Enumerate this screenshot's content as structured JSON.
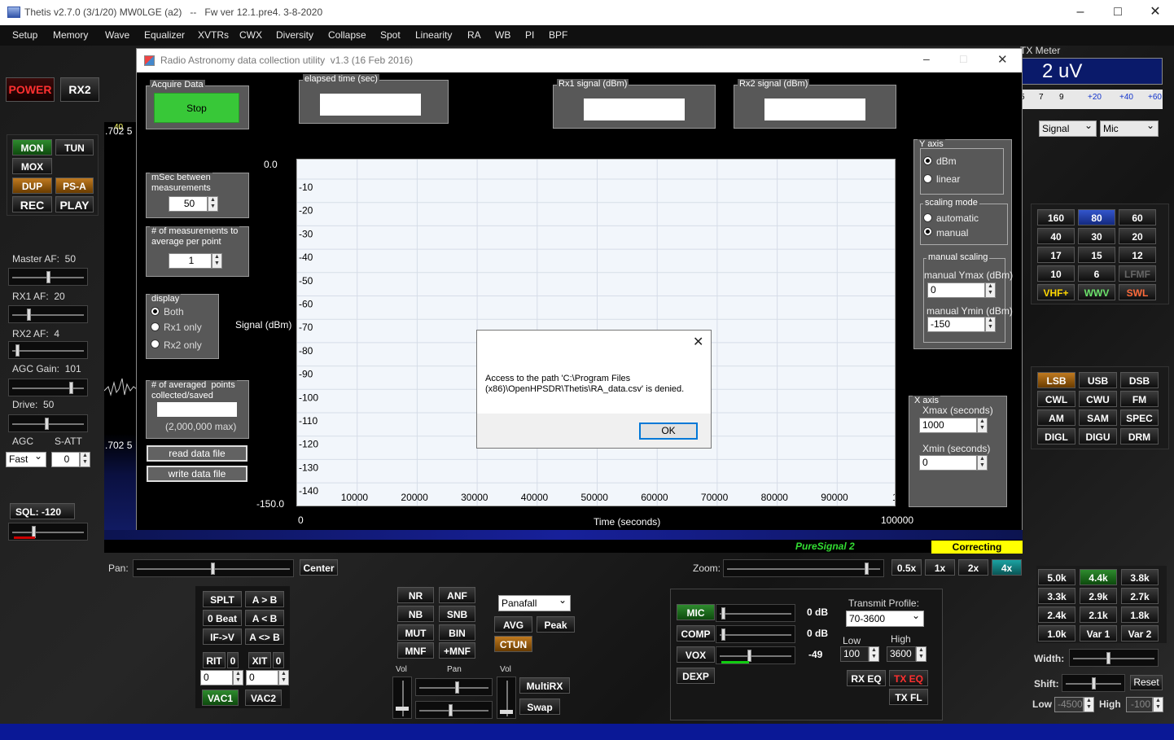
{
  "window": {
    "title": "Thetis v2.7.0 (3/1/20) MW0LGE (a2)   --   Fw ver 12.1.pre4. 3-8-2020"
  },
  "menu": [
    "Setup",
    "Memory",
    "Wave",
    "Equalizer",
    "XVTRs",
    "CWX",
    "Diversity",
    "Collapse",
    "Spot",
    "Linearity",
    "RA",
    "WB",
    "PI",
    "BPF"
  ],
  "left": {
    "power": "POWER",
    "rx2": "RX2",
    "mon": "MON",
    "tun": "TUN",
    "mox": "MOX",
    "dup": "DUP",
    "psa": "PS-A",
    "rec": "REC",
    "play": "PLAY",
    "master_af": "Master AF:  50",
    "rx1_af": "RX1 AF:  20",
    "rx2_af": "RX2 AF:  4",
    "agc_gain": "AGC Gain:  101",
    "drive": "Drive:  50",
    "agc": "AGC",
    "satt": "S-ATT",
    "agc_mode": "Fast",
    "satt_val": "0",
    "sql": "SQL:  -120",
    "freq1": ".702 5",
    "freq2": ".702 5",
    "freq1b": "40"
  },
  "right": {
    "txmeter": "TX Meter",
    "meter_value": "2 uV",
    "scale": [
      "5",
      "7",
      "9",
      "+20",
      "+40",
      "+60"
    ],
    "signal": "Signal",
    "mic": "Mic",
    "bands": [
      "160",
      "80",
      "60",
      "40",
      "30",
      "20",
      "17",
      "15",
      "12",
      "10",
      "6",
      "LFMF",
      "VHF+",
      "WWV",
      "SWL"
    ],
    "modes": [
      "LSB",
      "USB",
      "DSB",
      "CWL",
      "CWU",
      "FM",
      "AM",
      "SAM",
      "SPEC",
      "DIGL",
      "DIGU",
      "DRM"
    ],
    "filters": [
      "5.0k",
      "4.4k",
      "3.8k",
      "3.3k",
      "2.9k",
      "2.7k",
      "2.4k",
      "2.1k",
      "1.8k",
      "1.0k",
      "Var 1",
      "Var 2"
    ],
    "width": "Width:",
    "shift": "Shift:",
    "reset": "Reset",
    "low": "Low",
    "high": "High",
    "low_val": "-4500",
    "high_val": "-100"
  },
  "ra": {
    "title": "Radio Astronomy data collection utility  v1.3 (16 Feb 2016)",
    "acquire": "Acquire Data",
    "stop": "Stop",
    "elapsed": "elapsed time (sec)",
    "rx1sig": "Rx1 signal (dBm)",
    "rx2sig": "Rx2 signal (dBm)",
    "msec": "mSec between\nmeasurements",
    "msec_val": "50",
    "avg": "# of measurements to\naverage per point",
    "avg_val": "1",
    "display": "display",
    "both": "Both",
    "rx1only": "Rx1 only",
    "rx2only": "Rx2 only",
    "npoints": "# of averaged  points\ncollected/saved",
    "max": "(2,000,000 max)",
    "read": "read  data  file",
    "write": "write  data  file",
    "yaxis": "Y axis",
    "dbm": "dBm",
    "linear": "linear",
    "scaling": "scaling mode",
    "automatic": "automatic",
    "manual": "manual",
    "manual_scaling": "manual scaling",
    "ymax": "manual Ymax (dBm)",
    "ymax_val": "0",
    "ymin": "manual Ymin (dBm)",
    "ymin_val": "-150",
    "xaxis": "X axis",
    "xmax": "Xmax (seconds)",
    "xmax_val": "1000",
    "xmin": "Xmin (seconds)",
    "xmin_val": "0",
    "ylabel": "Signal (dBm)",
    "xlabel": "Time (seconds)",
    "ytop": "0.0",
    "ybot": "-150.0",
    "xleft": "0",
    "xright": "100000"
  },
  "chart_data": {
    "type": "line",
    "title": "",
    "xlabel": "Time (seconds)",
    "ylabel": "Signal (dBm)",
    "xlim": [
      0,
      100000
    ],
    "ylim": [
      -150,
      0
    ],
    "grid": true,
    "yticks": [
      "-10",
      "-20",
      "-30",
      "-40",
      "-50",
      "-60",
      "-70",
      "-80",
      "-90",
      "-100",
      "-110",
      "-120",
      "-130",
      "-140",
      "-150"
    ],
    "xticks": [
      "10000",
      "20000",
      "30000",
      "40000",
      "50000",
      "60000",
      "70000",
      "80000",
      "90000",
      "1"
    ],
    "series": []
  },
  "msg": {
    "text": "Access to the path 'C:\\Program Files\n(x86)\\OpenHPSDR\\Thetis\\RA_data.csv' is denied.",
    "ok": "OK"
  },
  "bottom": {
    "pure": "PureSignal 2",
    "correcting": "Correcting",
    "pan": "Pan:",
    "center": "Center",
    "zoom": "Zoom:",
    "z1": "0.5x",
    "z2": "1x",
    "z3": "2x",
    "z4": "4x",
    "splt": "SPLT",
    "atob": "A > B",
    "beat": "0 Beat",
    "btoa": "A < B",
    "ifv": "IF->V",
    "swap_ab": "A <> B",
    "rit": "RIT",
    "rit_n": "0",
    "xit": "XIT",
    "xit_n": "0",
    "rit_val": "0",
    "xit_val": "0",
    "vac1": "VAC1",
    "vac2": "VAC2",
    "nr": "NR",
    "anf": "ANF",
    "nb": "NB",
    "snb": "SNB",
    "mut": "MUT",
    "bin": "BIN",
    "mnf": "MNF",
    "pmnf": "+MNF",
    "panafall": "Panafall",
    "avg": "AVG",
    "peak": "Peak",
    "ctun": "CTUN",
    "vol": "Vol",
    "pan2": "Pan",
    "vol2": "Vol",
    "multirx": "MultiRX",
    "swap": "Swap",
    "micb": "MIC",
    "comp": "COMP",
    "vox": "VOX",
    "dexp": "DEXP",
    "mic_db": "0 dB",
    "comp_db": "0 dB",
    "vox_val": "-49",
    "txprofile": "Transmit Profile:",
    "profile": "70-3600",
    "lowl": "Low",
    "highl": "High",
    "low_val": "100",
    "high_val": "3600",
    "rxeq": "RX EQ",
    "txeq": "TX EQ",
    "txfl": "TX FL"
  }
}
